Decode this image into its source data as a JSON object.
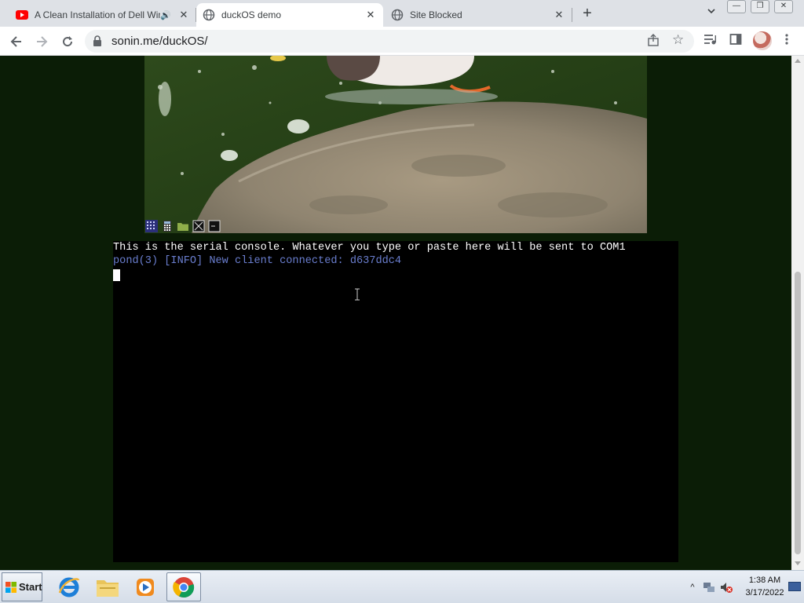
{
  "browser": {
    "tabs": [
      {
        "title": "A Clean Installation of Dell Win",
        "favicon": "youtube-icon",
        "audio": true,
        "active": false
      },
      {
        "title": "duckOS demo",
        "favicon": "globe-icon",
        "audio": false,
        "active": true
      },
      {
        "title": "Site Blocked",
        "favicon": "globe-icon",
        "audio": false,
        "active": false
      }
    ],
    "url": "sonin.me/duckOS/"
  },
  "console": {
    "line1": "This is the serial console. Whatever you type or paste here will be sent to COM1",
    "line2": "pond(3) [INFO] New client connected: d637ddc4"
  },
  "taskbar": {
    "start_label": "Start",
    "apps": [
      "internet-explorer-icon",
      "file-explorer-icon",
      "media-player-icon",
      "chrome-icon"
    ],
    "clock_time": "1:38 AM",
    "clock_date": "3/17/2022"
  },
  "colors": {
    "page_bg": "#0b1d06",
    "console_bg": "#000000",
    "console_text": "#ffffff",
    "console_info": "#6a7ecf",
    "tabstrip_bg": "#dee1e6"
  }
}
